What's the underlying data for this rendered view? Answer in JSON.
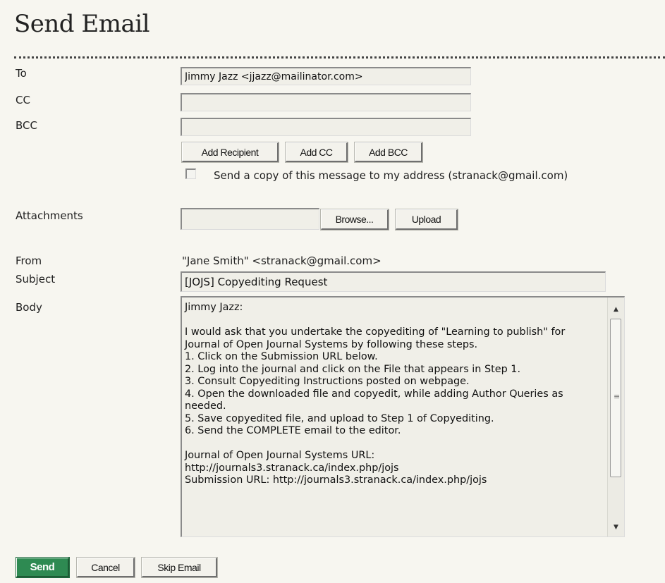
{
  "page": {
    "title": "Send Email"
  },
  "form": {
    "to_label": "To",
    "to_value": "Jimmy Jazz <jjazz@mailinator.com>",
    "cc_label": "CC",
    "cc_value": "",
    "bcc_label": "BCC",
    "bcc_value": "",
    "add_recipient_label": "Add Recipient",
    "add_cc_label": "Add CC",
    "add_bcc_label": "Add BCC",
    "copy_checkbox_label": "Send a copy of this message to my address (stranack@gmail.com)",
    "copy_checked": false,
    "attachments_label": "Attachments",
    "attachment_value": "",
    "browse_label": "Browse...",
    "upload_label": "Upload",
    "from_label": "From",
    "from_value": "\"Jane Smith\" <stranack@gmail.com>",
    "subject_label": "Subject",
    "subject_value": "[JOJS] Copyediting Request",
    "body_label": "Body",
    "body_value": "Jimmy Jazz:\n\nI would ask that you undertake the copyediting of \"Learning to publish\" for Journal of Open Journal Systems by following these steps.\n1. Click on the Submission URL below.\n2. Log into the journal and click on the File that appears in Step 1.\n3. Consult Copyediting Instructions posted on webpage.\n4. Open the downloaded file and copyedit, while adding Author Queries as needed.\n5. Save copyedited file, and upload to Step 1 of Copyediting.\n6. Send the COMPLETE email to the editor.\n\nJournal of Open Journal Systems URL:\nhttp://journals3.stranack.ca/index.php/jojs\nSubmission URL: http://journals3.stranack.ca/index.php/jojs"
  },
  "actions": {
    "send_label": "Send",
    "cancel_label": "Cancel",
    "skip_label": "Skip Email"
  },
  "colors": {
    "background": "#f7f6f0",
    "send_button": "#2e8a52"
  }
}
